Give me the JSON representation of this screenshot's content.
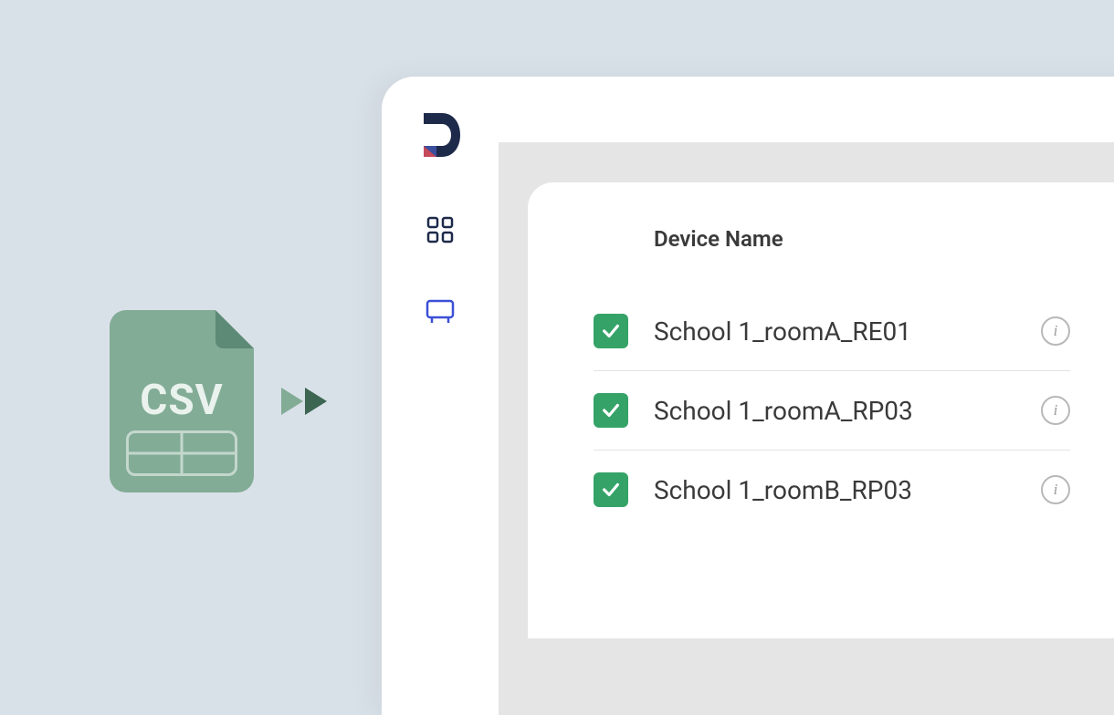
{
  "csv": {
    "label": "CSV"
  },
  "table": {
    "header": "Device Name",
    "rows": [
      {
        "name": "School 1_roomA_RE01",
        "checked": true
      },
      {
        "name": "School 1_roomA_RP03",
        "checked": true
      },
      {
        "name": "School 1_roomB_RP03",
        "checked": true
      }
    ]
  }
}
